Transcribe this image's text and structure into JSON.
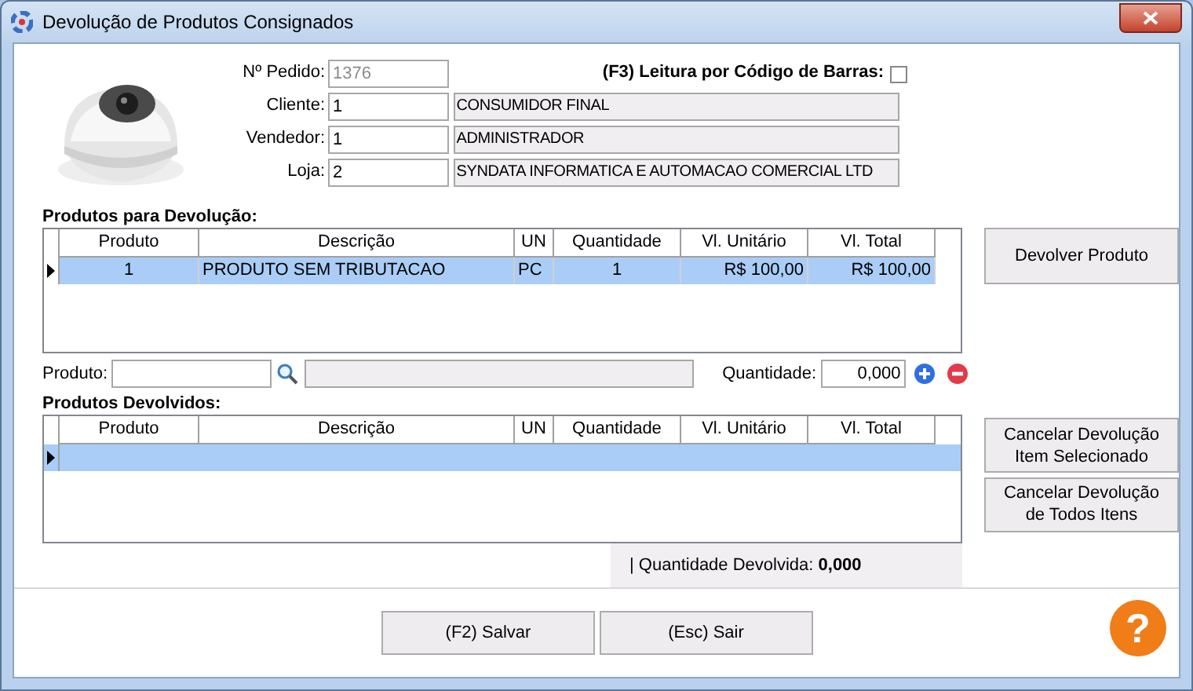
{
  "window": {
    "title": "Devolução de Produtos Consignados"
  },
  "header": {
    "fields": [
      {
        "label": "Nº Pedido:",
        "value": "1376",
        "disabled": true
      },
      {
        "label": "Cliente:",
        "value": "1",
        "disabled": false,
        "description": "CONSUMIDOR FINAL"
      },
      {
        "label": "Vendedor:",
        "value": "1",
        "disabled": false,
        "description": "ADMINISTRADOR"
      },
      {
        "label": "Loja:",
        "value": "2",
        "disabled": false,
        "description": "SYNDATA INFORMATICA E AUTOMACAO COMERCIAL LTD"
      }
    ],
    "barcode": {
      "label": "(F3) Leitura por Código de Barras:",
      "checked": false
    }
  },
  "products_to_return": {
    "title": "Produtos para Devolução:",
    "columns": [
      "Produto",
      "Descrição",
      "UN",
      "Quantidade",
      "Vl. Unitário",
      "Vl. Total"
    ],
    "rows": [
      {
        "selected": true,
        "cells": [
          "1",
          "PRODUTO SEM TRIBUTACAO",
          "PC",
          "1",
          "R$ 100,00",
          "R$ 100,00"
        ]
      }
    ]
  },
  "return_button": "Devolver Produto",
  "entry": {
    "product_label": "Produto:",
    "quantity_label": "Quantidade:",
    "quantity_value": "0,000"
  },
  "returned_products": {
    "title": "Produtos Devolvidos:",
    "columns": [
      "Produto",
      "Descrição",
      "UN",
      "Quantidade",
      "Vl. Unitário",
      "Vl. Total"
    ],
    "rows": [
      {
        "selected": true
      }
    ]
  },
  "cancel_buttons": [
    "Cancelar Devolução Item Selecionado",
    "Cancelar Devolução de Todos Itens"
  ],
  "summary": {
    "label": "| Quantidade Devolvida:",
    "value": "0,000"
  },
  "footer_buttons": [
    "(F2) Salvar",
    "(Esc) Sair"
  ],
  "help": {
    "label": "?"
  }
}
